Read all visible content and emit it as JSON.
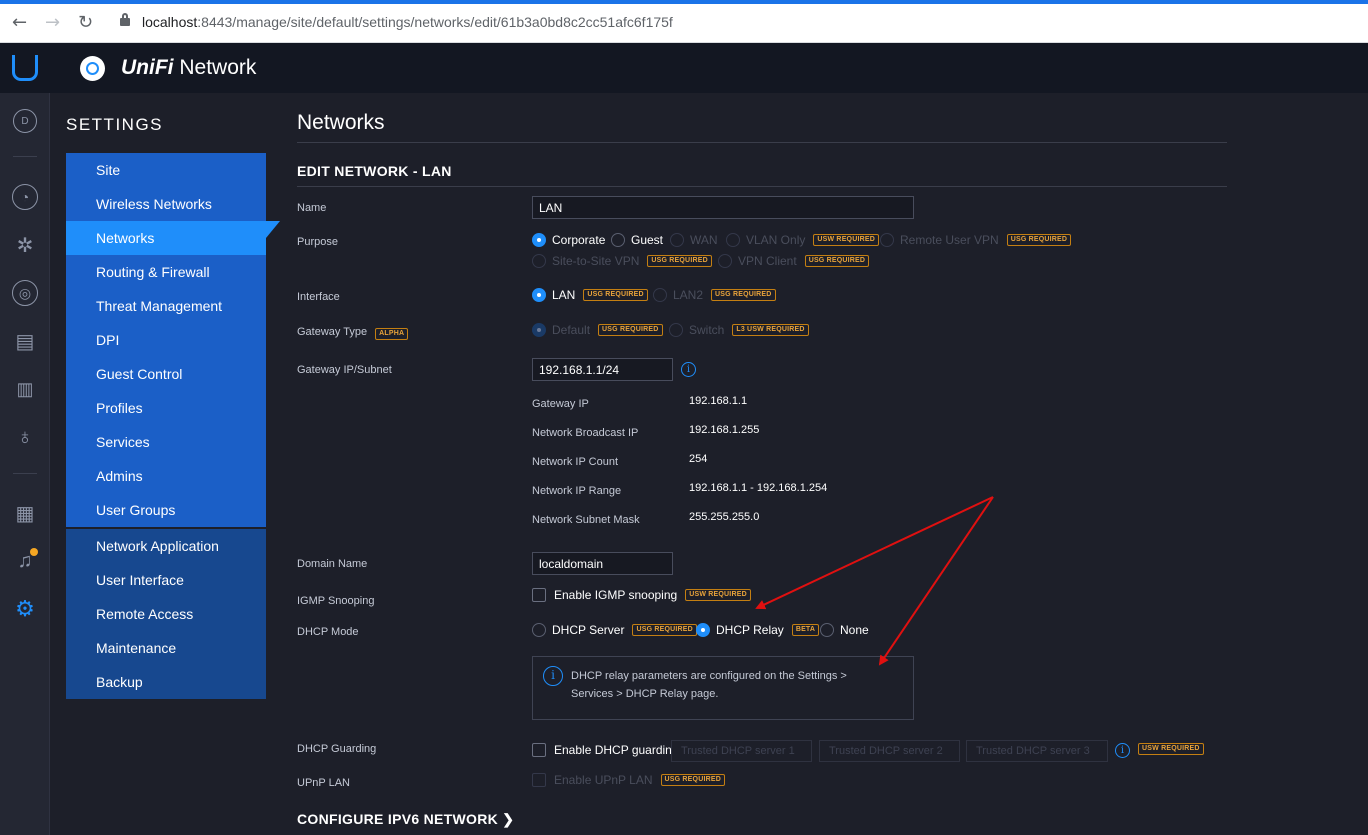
{
  "browser": {
    "url_host": "localhost",
    "url_rest": ":8443/manage/site/default/settings/networks/edit/61b3a0bd8c2cc51afc6f175f"
  },
  "app": {
    "brand_prefix": "UniFi",
    "brand_suffix": "Network",
    "site_letter": "D"
  },
  "sidebar": {
    "title": "SETTINGS",
    "group1": [
      "Site",
      "Wireless Networks",
      "Networks",
      "Routing & Firewall",
      "Threat Management",
      "DPI",
      "Guest Control",
      "Profiles",
      "Services",
      "Admins",
      "User Groups"
    ],
    "group2": [
      "Network Application",
      "User Interface",
      "Remote Access",
      "Maintenance",
      "Backup"
    ],
    "active": "Networks"
  },
  "main": {
    "page_title": "Networks",
    "section_title": "EDIT NETWORK - LAN",
    "name_label": "Name",
    "name_value": "LAN",
    "purpose_label": "Purpose",
    "purpose_options": {
      "corporate": "Corporate",
      "guest": "Guest",
      "wan": "WAN",
      "vlan_only": "VLAN Only",
      "remote_user_vpn": "Remote User VPN",
      "site_to_site_vpn": "Site-to-Site VPN",
      "vpn_client": "VPN Client"
    },
    "interface_label": "Interface",
    "interface_options": {
      "lan": "LAN",
      "lan2": "LAN2"
    },
    "gateway_type_label": "Gateway Type",
    "gateway_type_badge": "ALPHA",
    "gateway_type_options": {
      "default": "Default",
      "switch": "Switch"
    },
    "gateway_subnet_label": "Gateway IP/Subnet",
    "gateway_subnet_value": "192.168.1.1/24",
    "details": [
      {
        "k": "Gateway IP",
        "v": "192.168.1.1"
      },
      {
        "k": "Network Broadcast IP",
        "v": "192.168.1.255"
      },
      {
        "k": "Network IP Count",
        "v": "254"
      },
      {
        "k": "Network IP Range",
        "v": "192.168.1.1 - 192.168.1.254"
      },
      {
        "k": "Network Subnet Mask",
        "v": "255.255.255.0"
      }
    ],
    "domain_label": "Domain Name",
    "domain_value": "localdomain",
    "igmp_label": "IGMP Snooping",
    "igmp_check": "Enable IGMP snooping",
    "dhcp_mode_label": "DHCP Mode",
    "dhcp_mode_options": {
      "server": "DHCP Server",
      "relay": "DHCP Relay",
      "none": "None"
    },
    "dhcp_relay_badge": "BETA",
    "dhcp_info_line1": "DHCP relay parameters are configured on the Settings >",
    "dhcp_info_line2": "Services > DHCP Relay page.",
    "dhcp_guarding_label": "DHCP Guarding",
    "dhcp_guarding_check": "Enable DHCP guarding",
    "trusted_placeholders": [
      "Trusted DHCP server 1",
      "Trusted DHCP server 2",
      "Trusted DHCP server 3"
    ],
    "upnp_label": "UPnP LAN",
    "upnp_check": "Enable UPnP LAN",
    "configure_ipv6": "CONFIGURE IPV6 NETWORK",
    "badges": {
      "usw_required": "USW REQUIRED",
      "usg_required": "USG REQUIRED",
      "l3_usw_required": "L3 USW REQUIRED"
    }
  },
  "colors": {
    "accent": "#1f8efa",
    "annotation_arrow": "#e01010",
    "badge": "#e8a33a"
  }
}
